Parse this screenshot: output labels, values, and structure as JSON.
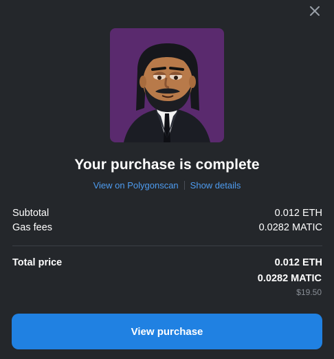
{
  "modal": {
    "title": "Your purchase is complete",
    "links": {
      "polygonscan": "View on Polygonscan",
      "details": "Show details"
    }
  },
  "icons": {
    "close": "close-icon"
  },
  "summary": {
    "subtotal_label": "Subtotal",
    "subtotal_value": "0.012 ETH",
    "gas_label": "Gas fees",
    "gas_value": "0.0282 MATIC",
    "total_label": "Total price",
    "total_eth": "0.012 ETH",
    "total_matic": "0.0282 MATIC",
    "total_usd": "$19.50"
  },
  "actions": {
    "view_purchase": "View purchase"
  },
  "colors": {
    "background": "#24272b",
    "accent": "#2081e2",
    "link": "#4e9cf0",
    "avatar_bg": "#5a2a6e"
  }
}
